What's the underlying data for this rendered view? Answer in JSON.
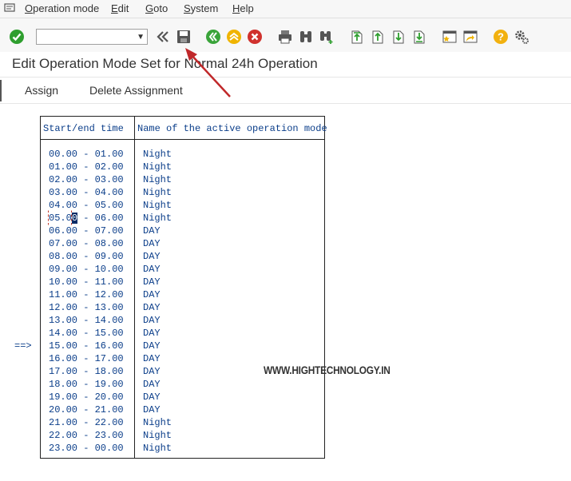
{
  "menubar": {
    "items": [
      {
        "underlined": "O",
        "rest": "peration mode"
      },
      {
        "underlined": "E",
        "rest": "dit"
      },
      {
        "underlined": "G",
        "rest": "oto"
      },
      {
        "underlined": "S",
        "rest": "ystem"
      },
      {
        "underlined": "H",
        "rest": "elp"
      }
    ]
  },
  "toolbar": {
    "command_field_value": ""
  },
  "title": "Edit Operation Mode Set for Normal 24h Operation",
  "app_toolbar": {
    "assign_label": "Assign",
    "delete_assignment_label": "Delete Assignment"
  },
  "table": {
    "header_time": "Start/end time",
    "header_mode": "Name of the active operation mode",
    "rows": [
      {
        "time": "00.00 - 01.00",
        "mode": "Night"
      },
      {
        "time": "01.00 - 02.00",
        "mode": "Night"
      },
      {
        "time": "02.00 - 03.00",
        "mode": "Night"
      },
      {
        "time": "03.00 - 04.00",
        "mode": "Night"
      },
      {
        "time": "04.00 - 05.00",
        "mode": "Night"
      },
      {
        "time": "05.00 - 06.00",
        "mode": "Night"
      },
      {
        "time": "06.00 - 07.00",
        "mode": "DAY"
      },
      {
        "time": "07.00 - 08.00",
        "mode": "DAY"
      },
      {
        "time": "08.00 - 09.00",
        "mode": "DAY"
      },
      {
        "time": "09.00 - 10.00",
        "mode": "DAY"
      },
      {
        "time": "10.00 - 11.00",
        "mode": "DAY"
      },
      {
        "time": "11.00 - 12.00",
        "mode": "DAY"
      },
      {
        "time": "12.00 - 13.00",
        "mode": "DAY"
      },
      {
        "time": "13.00 - 14.00",
        "mode": "DAY"
      },
      {
        "time": "14.00 - 15.00",
        "mode": "DAY"
      },
      {
        "time": "15.00 - 16.00",
        "mode": "DAY"
      },
      {
        "time": "16.00 - 17.00",
        "mode": "DAY"
      },
      {
        "time": "17.00 - 18.00",
        "mode": "DAY"
      },
      {
        "time": "18.00 - 19.00",
        "mode": "DAY"
      },
      {
        "time": "19.00 - 20.00",
        "mode": "DAY"
      },
      {
        "time": "20.00 - 21.00",
        "mode": "DAY"
      },
      {
        "time": "21.00 - 22.00",
        "mode": "Night"
      },
      {
        "time": "22.00 - 23.00",
        "mode": "Night"
      },
      {
        "time": "23.00 - 00.00",
        "mode": "Night"
      }
    ]
  },
  "current_row_marker": "==>",
  "watermark": "WWW.HIGHTECHNOLOGY.IN",
  "colors": {
    "table_text": "#0b3e8a",
    "enter_green": "#2e9e2e",
    "nav_green": "#3aa43a",
    "nav_yellow": "#f0b400",
    "cancel_red": "#d0312d",
    "help_yellow": "#f2b10f",
    "annotation_arrow": "#c0282a"
  },
  "icons": [
    "sap-menu-icon",
    "enter-check-icon",
    "back-double-arrow-icon",
    "save-icon",
    "back-green-icon",
    "exit-up-icon",
    "cancel-red-icon",
    "print-icon",
    "find-binoculars-icon",
    "find-next-binoculars-icon",
    "first-page-icon",
    "previous-page-icon",
    "next-page-icon",
    "last-page-icon",
    "create-session-icon",
    "generate-shortcut-icon",
    "help-icon",
    "settings-gear-icon"
  ]
}
